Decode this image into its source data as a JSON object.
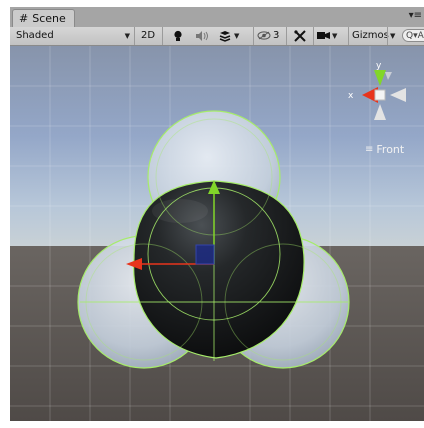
{
  "tab": {
    "title": "Scene",
    "menu": "▾≡"
  },
  "toolbar": {
    "shading_mode": "Shaded",
    "mode_2d": "2D",
    "hidden_count": "3",
    "gizmos_label": "Gizmos",
    "search_placeholder": "Q▾All"
  },
  "gizmo": {
    "y_label": "y",
    "x_label": "x",
    "view_label": "Front"
  },
  "colors": {
    "x_axis": "#e8341c",
    "y_axis": "#82d629",
    "selection_outline": "#a6ec6a",
    "sphere_dark": "#1e2022",
    "transparent_sphere": "#d9e1ea"
  },
  "icons": [
    "scene-grid-icon",
    "lightbulb-icon",
    "audio-icon",
    "effects-icon",
    "visibility-icon",
    "tools-icon",
    "camera-icon",
    "search-icon",
    "list-icon"
  ]
}
